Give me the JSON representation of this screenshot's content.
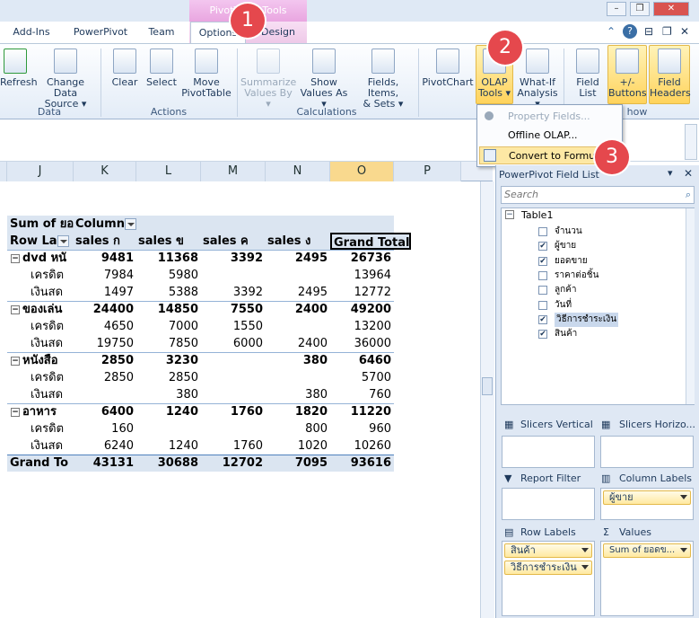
{
  "window": {
    "context_tab": "PivotTable Tools",
    "controls": [
      "–",
      "❐",
      "✕"
    ],
    "help": "?",
    "pin": "⊟",
    "restore": "❐",
    "close": "✕"
  },
  "tabs": [
    "Add-Ins",
    "PowerPivot",
    "Team",
    "Options",
    "Design"
  ],
  "ribbon": {
    "data_group": {
      "label": "Data",
      "refresh": "Refresh",
      "change_source_line1": "Change Data",
      "change_source_line2": "Source ▾"
    },
    "actions_group": {
      "label": "Actions",
      "clear": "Clear",
      "select": "Select",
      "move_line1": "Move",
      "move_line2": "PivotTable"
    },
    "calc_group": {
      "label": "Calculations",
      "summarize_line1": "Summarize",
      "summarize_line2": "Values By ▾",
      "show_line1": "Show",
      "show_line2": "Values As ▾",
      "fields_line1": "Fields, Items,",
      "fields_line2": "& Sets ▾"
    },
    "tools_group": {
      "pivotchart": "PivotChart",
      "olap_line1": "OLAP",
      "olap_line2": "Tools ▾",
      "whatif_line1": "What-If",
      "whatif_line2": "Analysis ▾",
      "fieldlist_line1": "Field",
      "fieldlist_line2": "List",
      "buttons_line1": "+/-",
      "buttons_line2": "Buttons",
      "headers_line1": "Field",
      "headers_line2": "Headers",
      "show_label": "how"
    }
  },
  "olap_menu": {
    "items": [
      {
        "label": "Property Fields...",
        "disabled": true
      },
      {
        "label": "Offline OLAP...",
        "disabled": false
      },
      {
        "label": "Convert to Formulas",
        "disabled": false,
        "highlighted": true
      }
    ]
  },
  "badges": {
    "one": "1",
    "two": "2",
    "three": "3"
  },
  "columns": [
    "J",
    "K",
    "L",
    "M",
    "N",
    "O",
    "P"
  ],
  "pivot": {
    "header1": {
      "sum_label": "Sum of ยอ",
      "col_labels": "Column"
    },
    "header2": {
      "row_labels": "Row La",
      "cols": [
        "sales ก",
        "sales ข",
        "sales ค",
        "sales ง",
        "Grand Total"
      ]
    },
    "groups": [
      {
        "name": "dvd หนั",
        "values": [
          "9481",
          "11368",
          "3392",
          "2495",
          "26736"
        ],
        "rows": [
          {
            "name": "เครดิต",
            "values": [
              "7984",
              "5980",
              "",
              "",
              "13964"
            ]
          },
          {
            "name": "เงินสด",
            "values": [
              "1497",
              "5388",
              "3392",
              "2495",
              "12772"
            ]
          }
        ]
      },
      {
        "name": "ของเล่น",
        "values": [
          "24400",
          "14850",
          "7550",
          "2400",
          "49200"
        ],
        "rows": [
          {
            "name": "เครดิต",
            "values": [
              "4650",
              "7000",
              "1550",
              "",
              "13200"
            ]
          },
          {
            "name": "เงินสด",
            "values": [
              "19750",
              "7850",
              "6000",
              "2400",
              "36000"
            ]
          }
        ]
      },
      {
        "name": "หนังสือ",
        "values": [
          "2850",
          "3230",
          "",
          "380",
          "6460"
        ],
        "rows": [
          {
            "name": "เครดิต",
            "values": [
              "2850",
              "2850",
              "",
              "",
              "5700"
            ]
          },
          {
            "name": "เงินสด",
            "values": [
              "",
              "380",
              "",
              "380",
              "760"
            ]
          }
        ]
      },
      {
        "name": "อาหาร",
        "values": [
          "6400",
          "1240",
          "1760",
          "1820",
          "11220"
        ],
        "rows": [
          {
            "name": "เครดิต",
            "values": [
              "160",
              "",
              "",
              "800",
              "960"
            ]
          },
          {
            "name": "เงินสด",
            "values": [
              "6240",
              "1240",
              "1760",
              "1020",
              "10260"
            ]
          }
        ]
      }
    ],
    "grand_total": {
      "name": "Grand To",
      "values": [
        "43131",
        "30688",
        "12702",
        "7095",
        "93616"
      ]
    }
  },
  "field_list": {
    "title": "PowerPivot Field List",
    "search_placeholder": "Search",
    "table_name": "Table1",
    "fields": [
      {
        "name": "จำนวน",
        "checked": false
      },
      {
        "name": "ผู้ขาย",
        "checked": true
      },
      {
        "name": "ยอดขาย",
        "checked": true
      },
      {
        "name": "ราคาต่อชิ้น",
        "checked": false
      },
      {
        "name": "ลูกค้า",
        "checked": false
      },
      {
        "name": "วันที่",
        "checked": false
      },
      {
        "name": "วิธีการชำระเงิน",
        "checked": true
      },
      {
        "name": "สินค้า",
        "checked": true
      }
    ],
    "slicers_vertical": "Slicers Vertical",
    "slicers_horizontal": "Slicers Horizo...",
    "report_filter": "Report Filter",
    "column_labels": "Column Labels",
    "column_pill": "ผู้ขาย",
    "row_labels": "Row Labels",
    "row_pills": [
      "สินค้า",
      "วิธีการชำระเงิน"
    ],
    "values": "Values",
    "value_pill": "Sum of ยอดข..."
  }
}
